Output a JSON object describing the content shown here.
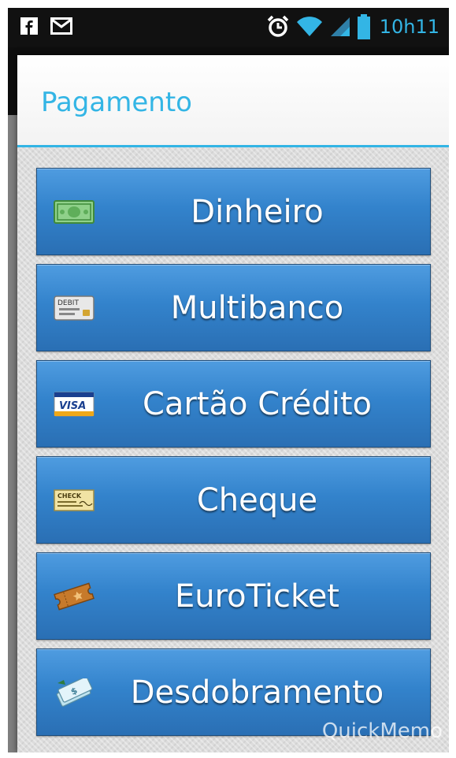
{
  "status_bar": {
    "time": "10h11",
    "icons_left": [
      "facebook-icon",
      "gmail-icon"
    ],
    "icons_right": [
      "alarm-icon",
      "wifi-icon",
      "signal-icon",
      "battery-icon"
    ],
    "accent_color": "#33b5e5"
  },
  "dialog": {
    "title": "Pagamento",
    "title_color": "#33b5e5",
    "options": [
      {
        "label": "Dinheiro",
        "icon": "cash-icon"
      },
      {
        "label": "Multibanco",
        "icon": "debit-card-icon"
      },
      {
        "label": "Cartão Crédito",
        "icon": "visa-card-icon"
      },
      {
        "label": "Cheque",
        "icon": "check-icon"
      },
      {
        "label": "EuroTicket",
        "icon": "ticket-icon"
      },
      {
        "label": "Desdobramento",
        "icon": "split-payment-icon"
      }
    ],
    "button_color": "#3383cc"
  },
  "watermark": {
    "text": "QuickMemo"
  }
}
